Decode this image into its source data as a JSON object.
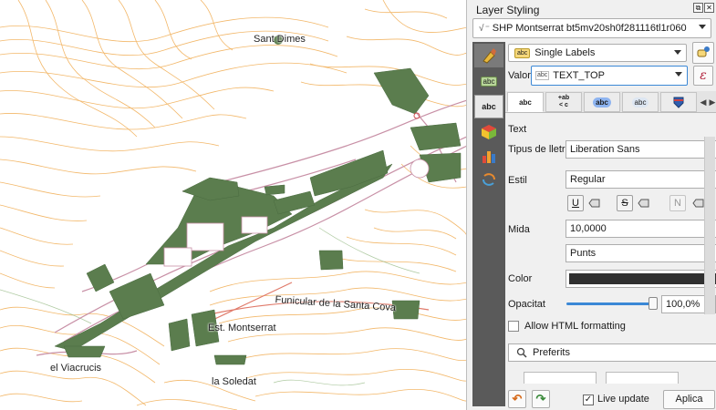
{
  "map": {
    "labels": {
      "sant_dimes": "Sant Dimes",
      "funicular": "Funicular de la Santa Cova",
      "est_montserrat": "Est. Montserrat",
      "viacrucis": "el Viacrucis",
      "soledat": "la Soledat"
    },
    "colors": {
      "contour": "#f2b462",
      "building": "#5b7d4e",
      "road": "#c890a6",
      "funicular_line": "#e07a6a"
    }
  },
  "panel": {
    "title": "Layer Styling",
    "layer_name": "SHP Montserrat bt5mv20sh0f281116tl1r060",
    "renderer": "Single Labels",
    "valor_label": "Valor",
    "valor_value": "TEXT_TOP",
    "expr_symbol": "ε",
    "section_title": "Text",
    "fields": {
      "font_label": "Tipus de lletra",
      "font_value": "Liberation Sans",
      "style_label": "Estil",
      "style_value": "Regular",
      "size_label": "Mida",
      "size_value": "10,0000",
      "unit_value": "Punts",
      "color_label": "Color",
      "opacity_label": "Opacitat",
      "opacity_value": "100,0%",
      "opacity_fraction": 1.0,
      "html_label": "Allow HTML formatting",
      "presets_label": "Preferits"
    },
    "style_buttons": [
      "U",
      "S",
      "N"
    ],
    "sub_tabs": [
      "abc",
      "+ab\n<c",
      "abc",
      "abc"
    ],
    "live_update_label": "Live update",
    "live_update_checked": true,
    "apply_label": "Aplica"
  }
}
